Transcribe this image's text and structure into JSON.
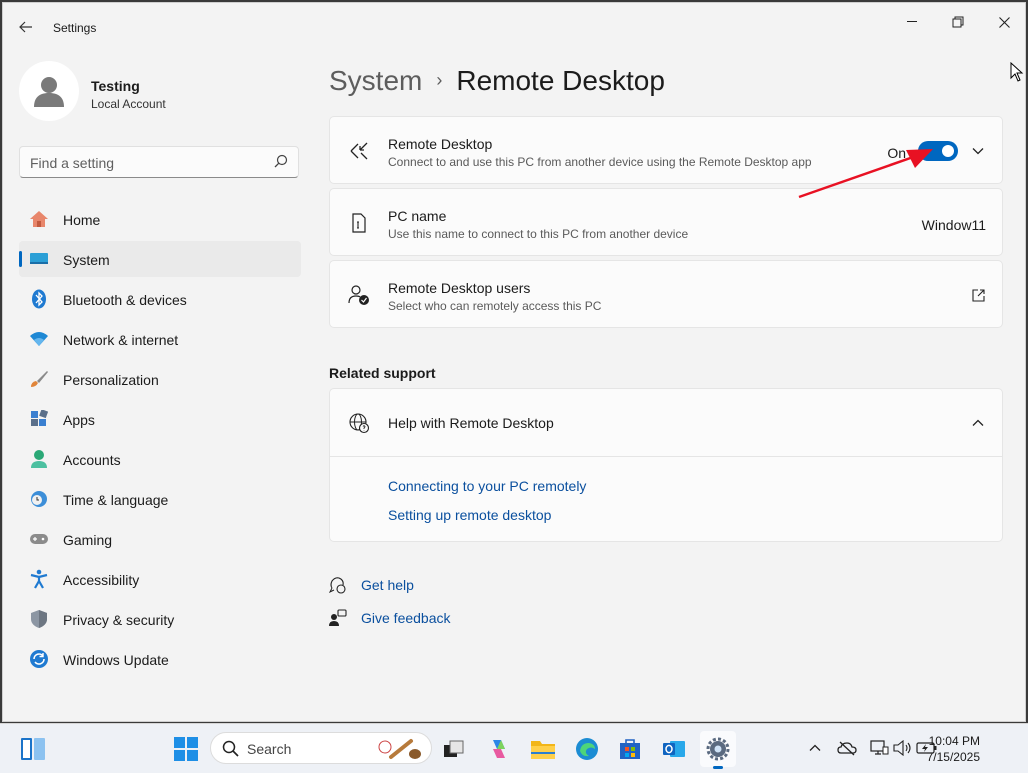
{
  "window": {
    "title": "Settings",
    "controls": {
      "minimize": "—",
      "maximize": "❐",
      "close": "✕"
    }
  },
  "profile": {
    "name": "Testing",
    "account_type": "Local Account"
  },
  "search": {
    "placeholder": "Find a setting"
  },
  "sidebar": {
    "items": [
      {
        "label": "Home",
        "icon": "home-icon",
        "active": false
      },
      {
        "label": "System",
        "icon": "system-icon",
        "active": true
      },
      {
        "label": "Bluetooth & devices",
        "icon": "bluetooth-icon",
        "active": false
      },
      {
        "label": "Network & internet",
        "icon": "wifi-icon",
        "active": false
      },
      {
        "label": "Personalization",
        "icon": "brush-icon",
        "active": false
      },
      {
        "label": "Apps",
        "icon": "apps-icon",
        "active": false
      },
      {
        "label": "Accounts",
        "icon": "accounts-icon",
        "active": false
      },
      {
        "label": "Time & language",
        "icon": "clock-globe-icon",
        "active": false
      },
      {
        "label": "Gaming",
        "icon": "gamepad-icon",
        "active": false
      },
      {
        "label": "Accessibility",
        "icon": "accessibility-icon",
        "active": false
      },
      {
        "label": "Privacy & security",
        "icon": "shield-icon",
        "active": false
      },
      {
        "label": "Windows Update",
        "icon": "update-icon",
        "active": false
      }
    ]
  },
  "breadcrumb": {
    "parent": "System",
    "separator": "›",
    "current": "Remote Desktop"
  },
  "remote_desktop": {
    "title": "Remote Desktop",
    "description": "Connect to and use this PC from another device using the Remote Desktop app",
    "toggle_state_label": "On",
    "enabled": true
  },
  "pc_name": {
    "title": "PC name",
    "description": "Use this name to connect to this PC from another device",
    "value": "Window11"
  },
  "rd_users": {
    "title": "Remote Desktop users",
    "description": "Select who can remotely access this PC"
  },
  "related_support": {
    "heading": "Related support",
    "help_title": "Help with Remote Desktop",
    "links": [
      "Connecting to your PC remotely",
      "Setting up remote desktop"
    ]
  },
  "footer": {
    "get_help": "Get help",
    "give_feedback": "Give feedback"
  },
  "taskbar": {
    "search_placeholder": "Search",
    "time": "10:04 PM",
    "date": "7/15/2025"
  },
  "colors": {
    "accent": "#0067c0",
    "link": "#0a4f9e",
    "annotation_arrow": "#e81123"
  }
}
